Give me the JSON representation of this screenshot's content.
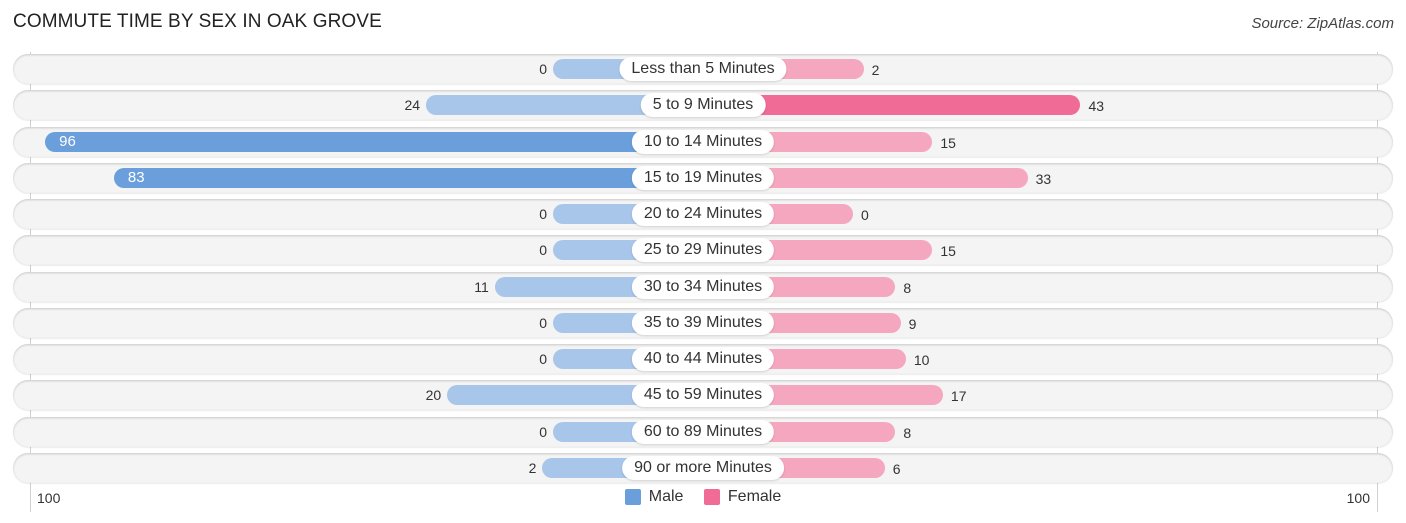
{
  "header": {
    "title": "COMMUTE TIME BY SEX IN OAK GROVE",
    "source": "Source: ZipAtlas.com"
  },
  "colors": {
    "male": "#6a9fdc",
    "male_light": "#a7c6ea",
    "female": "#f06b96",
    "female_light": "#f6a7c0"
  },
  "chart_data": {
    "type": "bar",
    "orientation": "horizontal-diverging",
    "title": "COMMUTE TIME BY SEX IN OAK GROVE",
    "categories": [
      "Less than 5 Minutes",
      "5 to 9 Minutes",
      "10 to 14 Minutes",
      "15 to 19 Minutes",
      "20 to 24 Minutes",
      "25 to 29 Minutes",
      "30 to 34 Minutes",
      "35 to 39 Minutes",
      "40 to 44 Minutes",
      "45 to 59 Minutes",
      "60 to 89 Minutes",
      "90 or more Minutes"
    ],
    "series": [
      {
        "name": "Male",
        "values": [
          0,
          24,
          96,
          83,
          0,
          0,
          11,
          0,
          0,
          20,
          0,
          2
        ]
      },
      {
        "name": "Female",
        "values": [
          2,
          43,
          15,
          33,
          0,
          15,
          8,
          9,
          10,
          17,
          8,
          6
        ]
      }
    ],
    "xlim": [
      -100,
      100
    ],
    "tick_labels": {
      "left": "100",
      "right": "100"
    },
    "legend": {
      "position": "bottom-center",
      "entries": [
        "Male",
        "Female"
      ]
    },
    "grid": false
  }
}
